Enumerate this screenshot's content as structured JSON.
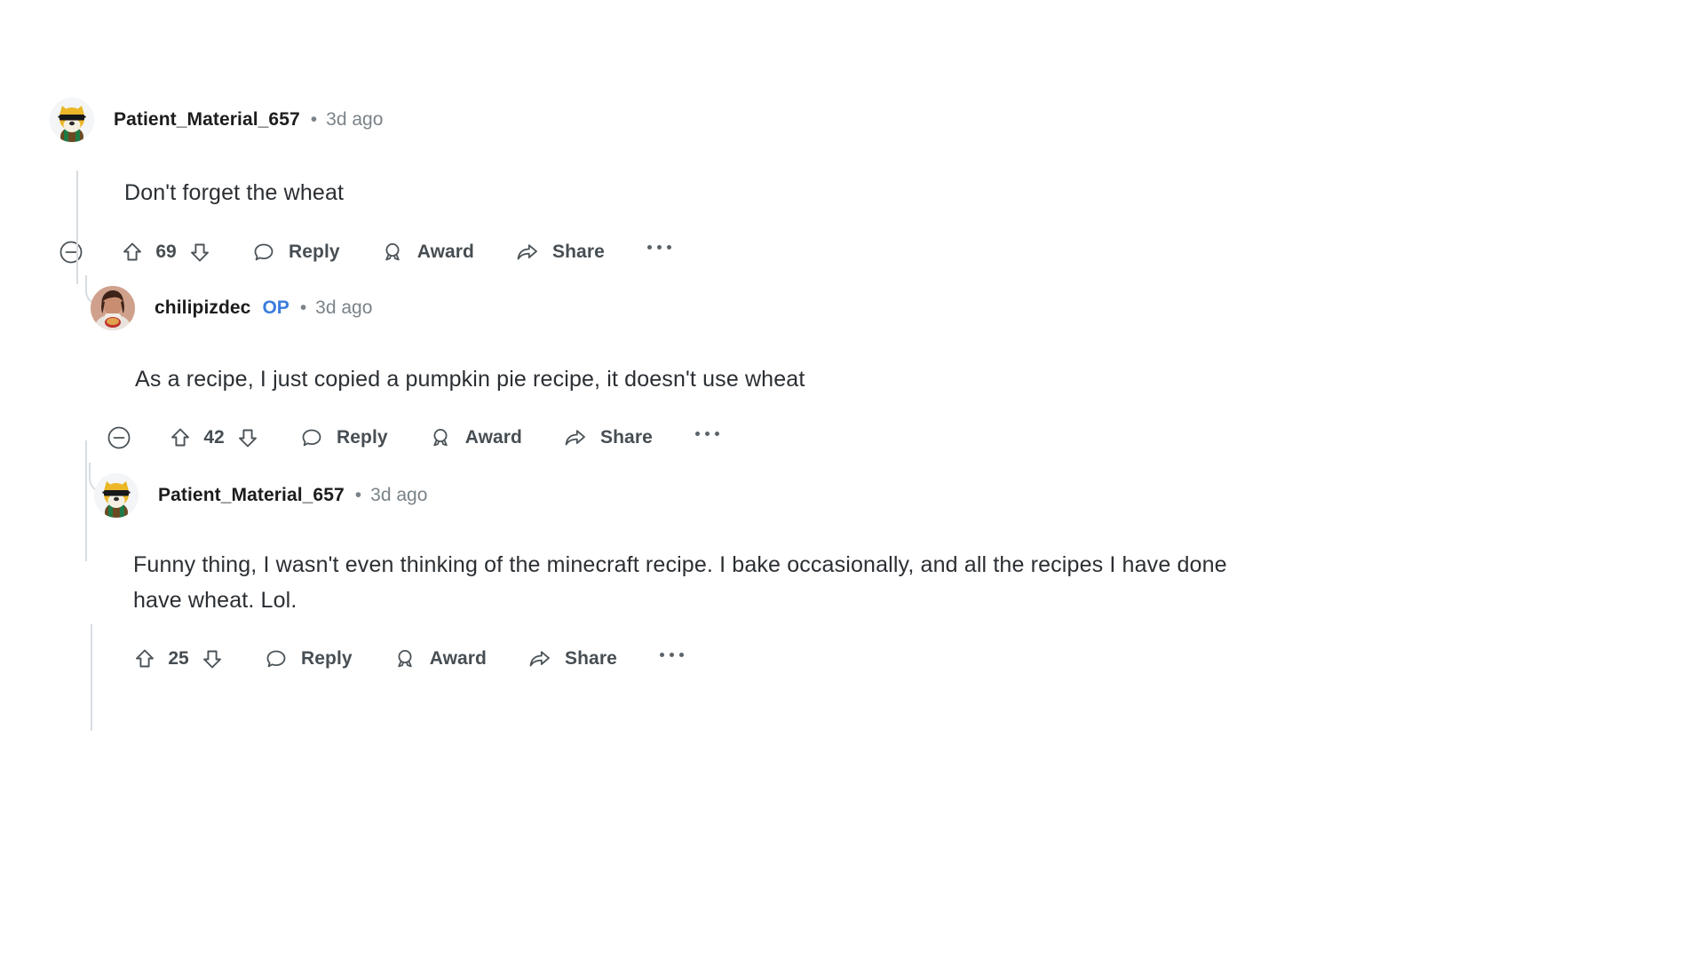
{
  "thread": {
    "comments": [
      {
        "id": "comment-1",
        "depth": 0,
        "username": "Patient_Material_657",
        "is_op": false,
        "op_label": "",
        "separator": "•",
        "timestamp": "3d ago",
        "body": "Don't forget the wheat",
        "avatar": "doge-sunglasses-avatar",
        "actions": {
          "collapse_icon": "collapse-minus-circle-icon",
          "upvote_icon": "upvote-arrow-icon",
          "downvote_icon": "downvote-arrow-icon",
          "vote_count": "69",
          "reply_icon": "comment-bubble-icon",
          "reply_label": "Reply",
          "award_icon": "award-medal-icon",
          "award_label": "Award",
          "share_icon": "share-arrow-icon",
          "share_label": "Share",
          "more_icon": "more-ellipsis-icon",
          "has_collapse": true
        }
      },
      {
        "id": "comment-2",
        "depth": 1,
        "username": "chilipizdec",
        "is_op": true,
        "op_label": "OP",
        "separator": "•",
        "timestamp": "3d ago",
        "body": "As a recipe, I just copied a pumpkin pie recipe, it doesn't use wheat",
        "avatar": "person-photo-avatar",
        "actions": {
          "collapse_icon": "collapse-minus-circle-icon",
          "upvote_icon": "upvote-arrow-icon",
          "downvote_icon": "downvote-arrow-icon",
          "vote_count": "42",
          "reply_icon": "comment-bubble-icon",
          "reply_label": "Reply",
          "award_icon": "award-medal-icon",
          "award_label": "Award",
          "share_icon": "share-arrow-icon",
          "share_label": "Share",
          "more_icon": "more-ellipsis-icon",
          "has_collapse": true
        }
      },
      {
        "id": "comment-3",
        "depth": 2,
        "username": "Patient_Material_657",
        "is_op": false,
        "op_label": "",
        "separator": "•",
        "timestamp": "3d ago",
        "body": "Funny thing, I wasn't even thinking of the minecraft recipe. I bake occasionally, and all the recipes I have done have wheat. Lol.",
        "avatar": "doge-sunglasses-avatar",
        "actions": {
          "collapse_icon": "",
          "upvote_icon": "upvote-arrow-icon",
          "downvote_icon": "downvote-arrow-icon",
          "vote_count": "25",
          "reply_icon": "comment-bubble-icon",
          "reply_label": "Reply",
          "award_icon": "award-medal-icon",
          "award_label": "Award",
          "share_icon": "share-arrow-icon",
          "share_label": "Share",
          "more_icon": "more-ellipsis-icon",
          "has_collapse": false
        }
      }
    ]
  },
  "colors": {
    "background": "#ffffff",
    "username": "#1c1c1c",
    "body_text": "#2b2f33",
    "meta_text": "#7a8389",
    "action_text": "#474e53",
    "op_blue": "#3a7ddd",
    "thread_line": "#d8dde2"
  }
}
